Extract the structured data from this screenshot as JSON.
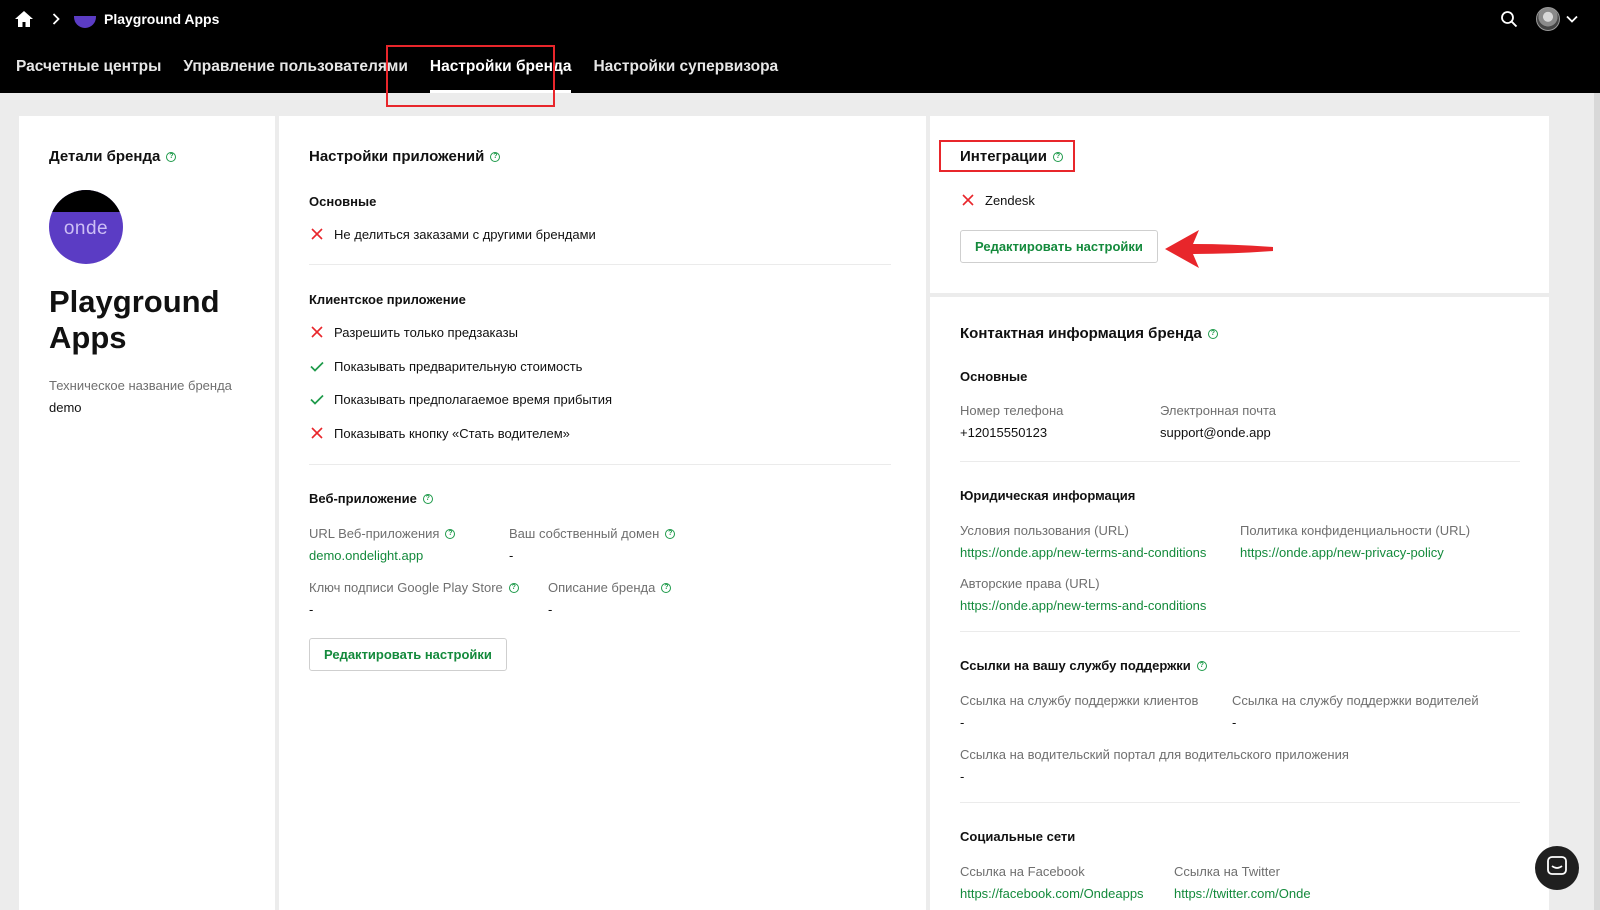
{
  "header": {
    "app_name": "Playground Apps",
    "tabs": [
      {
        "label": "Расчетные центры"
      },
      {
        "label": "Управление пользователями"
      },
      {
        "label": "Настройки бренда"
      },
      {
        "label": "Настройки супервизора"
      }
    ]
  },
  "brand": {
    "title": "Детали бренда",
    "logo_text": "onde",
    "name": "Playground Apps",
    "tech_label": "Техническое название бренда",
    "tech_value": "demo"
  },
  "app_settings": {
    "title": "Настройки приложений",
    "basic": {
      "heading": "Основные",
      "items": [
        {
          "label": "Не делиться заказами с другими брендами",
          "state": "off"
        }
      ]
    },
    "client": {
      "heading": "Клиентское приложение",
      "items": [
        {
          "label": "Разрешить только предзаказы",
          "state": "off"
        },
        {
          "label": "Показывать предварительную стоимость",
          "state": "on"
        },
        {
          "label": "Показывать предполагаемое время прибытия",
          "state": "on"
        },
        {
          "label": "Показывать кнопку «Стать водителем»",
          "state": "off"
        }
      ]
    },
    "web": {
      "heading": "Веб-приложение",
      "url_label": "URL Веб-приложения",
      "url_value": "demo.ondelight.app",
      "domain_label": "Ваш собственный домен",
      "domain_value": "-",
      "gplay_label": "Ключ подписи Google Play Store",
      "gplay_value": "-",
      "desc_label": "Описание бренда",
      "desc_value": "-"
    },
    "edit_button": "Редактировать настройки"
  },
  "integrations": {
    "title": "Интеграции",
    "items": [
      {
        "label": "Zendesk",
        "state": "off"
      }
    ],
    "edit_button": "Редактировать настройки"
  },
  "contacts": {
    "title": "Контактная информация бренда",
    "basic_heading": "Основные",
    "phone_label": "Номер телефона",
    "phone_value": "+12015550123",
    "email_label": "Электронная почта",
    "email_value": "support@onde.app",
    "legal_heading": "Юридическая информация",
    "terms_label": "Условия пользования (URL)",
    "terms_value": "https://onde.app/new-terms-and-conditions",
    "privacy_label": "Политика конфиденциальности (URL)",
    "privacy_value": "https://onde.app/new-privacy-policy",
    "copyright_label": "Авторские права (URL)",
    "copyright_value": "https://onde.app/new-terms-and-conditions",
    "support_heading": "Ссылки на вашу службу поддержки",
    "client_support_label": "Ссылка на службу поддержки клиентов",
    "client_support_value": "-",
    "driver_support_label": "Ссылка на службу поддержки водителей",
    "driver_support_value": "-",
    "driver_portal_label": "Ссылка на водительский портал для водительского приложения",
    "driver_portal_value": "-",
    "social_heading": "Социальные сети",
    "facebook_label": "Ссылка на Facebook",
    "facebook_value": "https://facebook.com/Ondeapps",
    "twitter_label": "Ссылка на Twitter",
    "twitter_value": "https://twitter.com/Onde"
  },
  "colors": {
    "accent_green": "#148a3c",
    "error_red": "#e8262b",
    "brand_purple": "#5b3cc4"
  }
}
